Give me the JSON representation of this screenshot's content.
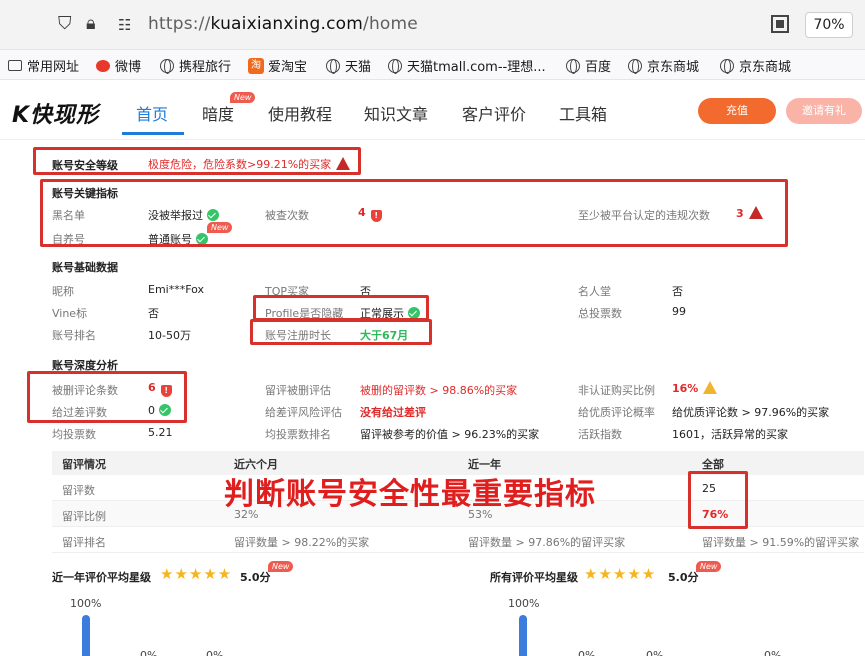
{
  "browser": {
    "url_prefix": "https://",
    "url_domain": "kuaixianxing.com",
    "url_path": "/home",
    "zoom": "70%",
    "bookmarks": [
      "常用网址",
      "微博",
      "携程旅行",
      "爱淘宝",
      "天猫",
      "天猫tmall.com--理想...",
      "百度",
      "京东商城",
      "京东商城"
    ]
  },
  "site": {
    "logo": "K快现形",
    "nav": [
      "首页",
      "暗度",
      "使用教程",
      "知识文章",
      "客户评价",
      "工具箱"
    ],
    "new_badge": "New",
    "btn_primary": "充值",
    "btn_secondary": "邀请有礼"
  },
  "security": {
    "label": "账号安全等级",
    "value": "极度危险，危险系数>99.21%的买家"
  },
  "key_metrics": {
    "title": "账号关键指标",
    "blacklist_label": "黑名单",
    "blacklist_value": "没被举报过",
    "checked_label": "被查次数",
    "checked_value": "4",
    "violation_label": "至少被平台认定的违规次数",
    "violation_value": "3",
    "self_label": "自养号",
    "self_value": "普通账号"
  },
  "basic": {
    "title": "账号基础数据",
    "nick_label": "昵称",
    "nick_value": "Emi***Fox",
    "top_label": "TOP买家",
    "top_value": "否",
    "famous_label": "名人堂",
    "famous_value": "否",
    "vine_label": "Vine标",
    "vine_value": "否",
    "profile_label": "Profile是否隐藏",
    "profile_value": "正常展示",
    "votes_label": "总投票数",
    "votes_value": "99",
    "rank_label": "账号排名",
    "rank_value": "10-50万",
    "reg_label": "账号注册时长",
    "reg_value": "大于67月"
  },
  "deep": {
    "title": "账号深度分析",
    "deleted_label": "被删评论条数",
    "deleted_value": "6",
    "deleted_eval_label": "留评被删评估",
    "deleted_eval_value": "被删的留评数 > 98.86%的买家",
    "nonverified_label": "非认证购买比例",
    "nonverified_value": "16%",
    "bad_label": "给过差评数",
    "bad_value": "0",
    "bad_risk_label": "给差评风险评估",
    "bad_risk_value": "没有给过差评",
    "good_label": "给优质评论概率",
    "good_value": "给优质评论数 > 97.96%的买家",
    "avg_votes_label": "均投票数",
    "avg_votes_value": "5.21",
    "avg_rank_label": "均投票数排名",
    "avg_rank_value": "留评被参考的价值 > 96.23%的买家",
    "active_label": "活跃指数",
    "active_value": "1601，活跃异常的买家"
  },
  "review_table": {
    "headers": [
      "留评情况",
      "近六个月",
      "近一年",
      "全部"
    ],
    "rows": [
      [
        "留评数",
        "",
        "",
        "25"
      ],
      [
        "留评比例",
        "32%",
        "53%",
        "76%"
      ],
      [
        "留评排名",
        "留评数量 > 98.22%的买家",
        "留评数量 > 97.86%的留评买家",
        "留评数量 > 91.59%的留评买家"
      ]
    ]
  },
  "overlay_text": "判断账号安全性最重要指标",
  "ratings": {
    "year_label": "近一年评价平均星级",
    "year_score": "5.0分",
    "all_label": "所有评价平均星级",
    "all_score": "5.0分",
    "stars": "★★★★★",
    "y_top": "100%",
    "y_zero": "0%"
  }
}
